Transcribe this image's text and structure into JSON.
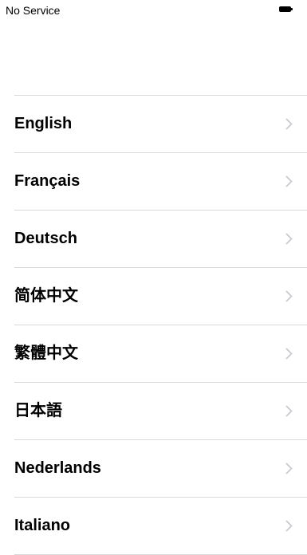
{
  "status_bar": {
    "carrier": "No Service",
    "battery_icon": "battery-full-icon"
  },
  "languages": {
    "items": [
      {
        "label": "English"
      },
      {
        "label": "Français"
      },
      {
        "label": "Deutsch"
      },
      {
        "label": "简体中文"
      },
      {
        "label": "繁體中文"
      },
      {
        "label": "日本語"
      },
      {
        "label": "Nederlands"
      },
      {
        "label": "Italiano"
      }
    ],
    "chevron_icon": "chevron-right-icon",
    "separator_color": "#d9d9d9",
    "chevron_color": "#c7c7cc"
  }
}
